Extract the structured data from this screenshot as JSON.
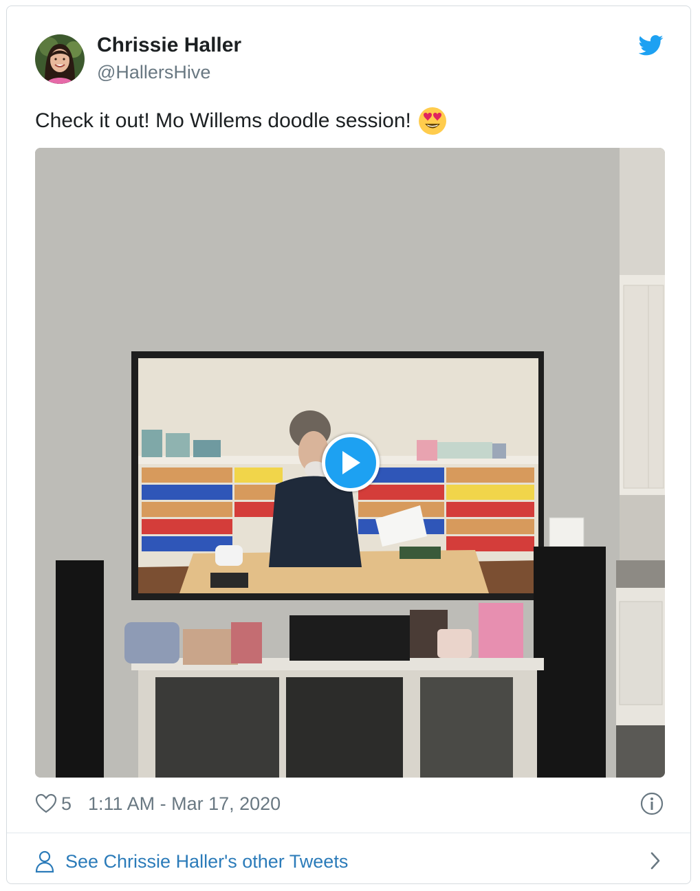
{
  "author": {
    "name": "Chrissie Haller",
    "handle": "@HallersHive"
  },
  "tweet": {
    "text": "Check it out! Mo Willems doodle session!",
    "emoji": "heart-eyes-emoji"
  },
  "media": {
    "type": "video",
    "play_icon": "play-icon"
  },
  "footer": {
    "likes": "5",
    "timestamp": "1:11 AM - Mar 17, 2020",
    "info_icon": "info-icon"
  },
  "see_more": {
    "label": "See Chrissie Haller's other Tweets"
  },
  "colors": {
    "brand": "#1da1f2",
    "link": "#2b7bb9",
    "muted": "#697882",
    "text": "#1c2022"
  }
}
